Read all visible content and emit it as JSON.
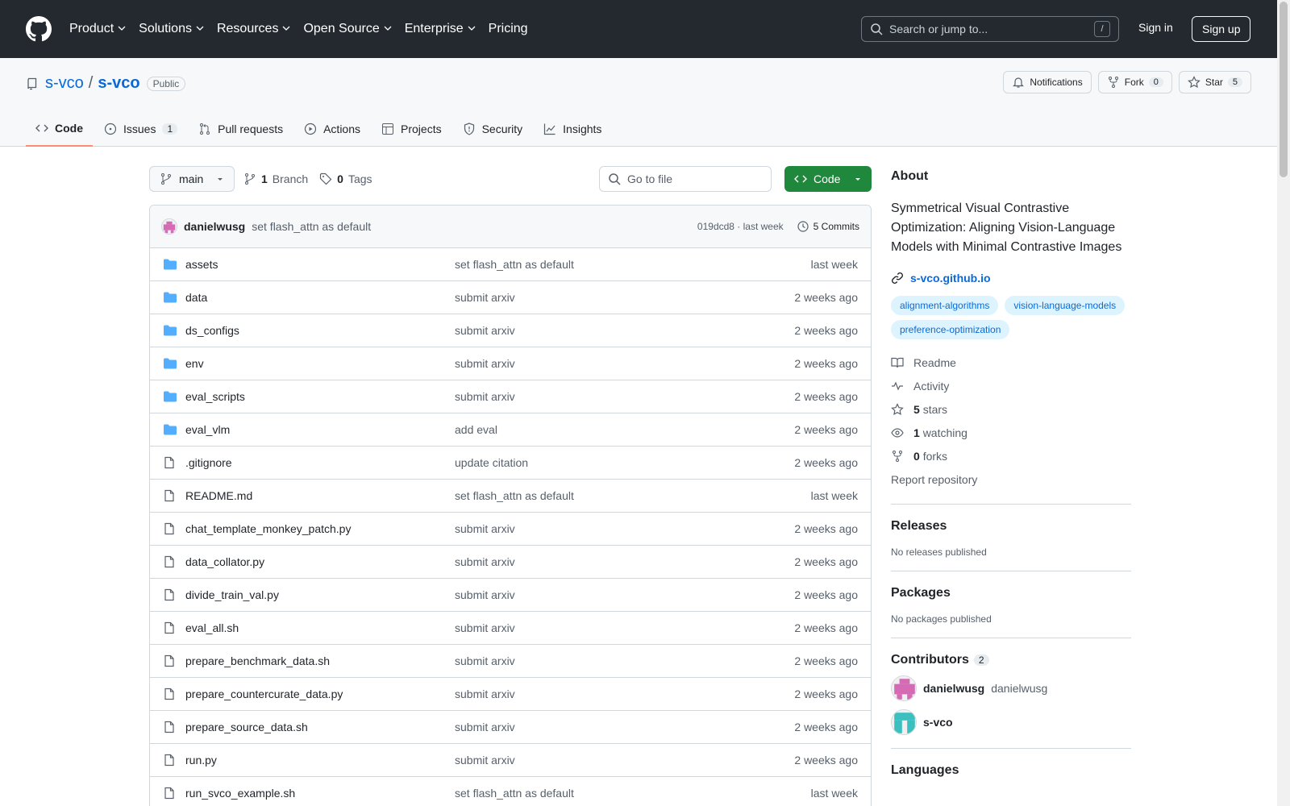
{
  "header": {
    "nav": [
      {
        "label": "Product",
        "dropdown": true
      },
      {
        "label": "Solutions",
        "dropdown": true
      },
      {
        "label": "Resources",
        "dropdown": true
      },
      {
        "label": "Open Source",
        "dropdown": true
      },
      {
        "label": "Enterprise",
        "dropdown": true
      },
      {
        "label": "Pricing",
        "dropdown": false
      }
    ],
    "search_placeholder": "Search or jump to...",
    "search_shortcut": "/",
    "signin": "Sign in",
    "signup": "Sign up"
  },
  "repo": {
    "owner": "s-vco",
    "separator": "/",
    "name": "s-vco",
    "visibility": "Public",
    "notifications_label": "Notifications",
    "fork_label": "Fork",
    "fork_count": "0",
    "star_label": "Star",
    "star_count": "5"
  },
  "tabs": [
    {
      "label": "Code",
      "icon": "code-icon",
      "active": true
    },
    {
      "label": "Issues",
      "icon": "issue-icon",
      "count": "1"
    },
    {
      "label": "Pull requests",
      "icon": "pull-request-icon"
    },
    {
      "label": "Actions",
      "icon": "play-icon"
    },
    {
      "label": "Projects",
      "icon": "table-icon"
    },
    {
      "label": "Security",
      "icon": "shield-icon"
    },
    {
      "label": "Insights",
      "icon": "graph-icon"
    }
  ],
  "controls": {
    "branch": "main",
    "branch_count": "1",
    "branch_label": "Branch",
    "tag_count": "0",
    "tag_label": "Tags",
    "goto_placeholder": "Go to file",
    "code_button": "Code"
  },
  "commit": {
    "author": "danielwusg",
    "message": "set flash_attn as default",
    "hash_time": "019dcd8 · last week",
    "commits": "5 Commits"
  },
  "files": [
    {
      "type": "folder",
      "name": "assets",
      "message": "set flash_attn as default",
      "date": "last week"
    },
    {
      "type": "folder",
      "name": "data",
      "message": "submit arxiv",
      "date": "2 weeks ago"
    },
    {
      "type": "folder",
      "name": "ds_configs",
      "message": "submit arxiv",
      "date": "2 weeks ago"
    },
    {
      "type": "folder",
      "name": "env",
      "message": "submit arxiv",
      "date": "2 weeks ago"
    },
    {
      "type": "folder",
      "name": "eval_scripts",
      "message": "submit arxiv",
      "date": "2 weeks ago"
    },
    {
      "type": "folder",
      "name": "eval_vlm",
      "message": "add eval",
      "date": "2 weeks ago"
    },
    {
      "type": "file",
      "name": ".gitignore",
      "message": "update citation",
      "date": "2 weeks ago"
    },
    {
      "type": "file",
      "name": "README.md",
      "message": "set flash_attn as default",
      "date": "last week"
    },
    {
      "type": "file",
      "name": "chat_template_monkey_patch.py",
      "message": "submit arxiv",
      "date": "2 weeks ago"
    },
    {
      "type": "file",
      "name": "data_collator.py",
      "message": "submit arxiv",
      "date": "2 weeks ago"
    },
    {
      "type": "file",
      "name": "divide_train_val.py",
      "message": "submit arxiv",
      "date": "2 weeks ago"
    },
    {
      "type": "file",
      "name": "eval_all.sh",
      "message": "submit arxiv",
      "date": "2 weeks ago"
    },
    {
      "type": "file",
      "name": "prepare_benchmark_data.sh",
      "message": "submit arxiv",
      "date": "2 weeks ago"
    },
    {
      "type": "file",
      "name": "prepare_countercurate_data.py",
      "message": "submit arxiv",
      "date": "2 weeks ago"
    },
    {
      "type": "file",
      "name": "prepare_source_data.sh",
      "message": "submit arxiv",
      "date": "2 weeks ago"
    },
    {
      "type": "file",
      "name": "run.py",
      "message": "submit arxiv",
      "date": "2 weeks ago"
    },
    {
      "type": "file",
      "name": "run_svco_example.sh",
      "message": "set flash_attn as default",
      "date": "last week"
    }
  ],
  "about": {
    "heading": "About",
    "description": "Symmetrical Visual Contrastive Optimization: Aligning Vision-Language Models with Minimal Contrastive Images",
    "homepage": "s-vco.github.io",
    "topics": [
      "alignment-algorithms",
      "vision-language-models",
      "preference-optimization"
    ],
    "readme": "Readme",
    "activity": "Activity",
    "stars_count": "5",
    "stars_label": "stars",
    "watching_count": "1",
    "watching_label": "watching",
    "forks_count": "0",
    "forks_label": "forks",
    "report": "Report repository"
  },
  "releases": {
    "heading": "Releases",
    "text": "No releases published"
  },
  "packages": {
    "heading": "Packages",
    "text": "No packages published"
  },
  "contributors": {
    "heading": "Contributors",
    "count": "2",
    "list": [
      {
        "name": "danielwusg",
        "login": "danielwusg",
        "color": "#d66bb5"
      },
      {
        "name": "s-vco",
        "login": "",
        "color": "#3bbfbf"
      }
    ]
  },
  "languages": {
    "heading": "Languages"
  },
  "colors": {
    "header_bg": "#24292f",
    "link": "#0969da",
    "code_button": "#1f883d",
    "active_tab": "#fd8c73",
    "folder": "#54aeff"
  }
}
